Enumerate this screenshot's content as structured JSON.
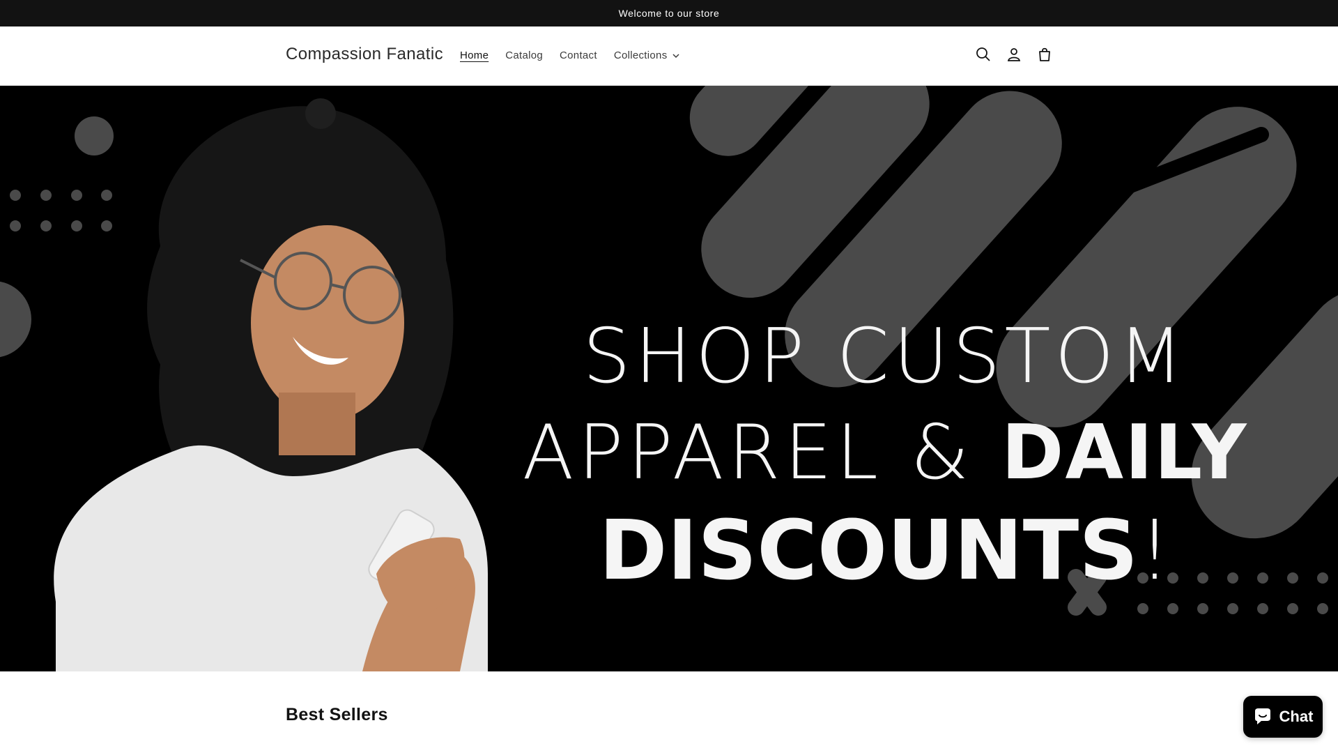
{
  "announcement": {
    "text": "Welcome to our store"
  },
  "header": {
    "logo": "Compassion Fanatic",
    "nav": [
      {
        "label": "Home",
        "active": true
      },
      {
        "label": "Catalog",
        "active": false
      },
      {
        "label": "Contact",
        "active": false
      },
      {
        "label": "Collections",
        "active": false,
        "has_dropdown": true
      }
    ],
    "icons": [
      "search-icon",
      "account-icon",
      "cart-icon"
    ]
  },
  "hero": {
    "line1": "SHOP CUSTOM",
    "line2_light": "APPAREL &",
    "line2_bold": "DAILY",
    "line3_bold": "DISCOUNTS",
    "line3_end": "!"
  },
  "best_sellers": {
    "title": "Best Sellers"
  },
  "chat": {
    "label": "Chat",
    "icon": "chat-bubble-icon"
  },
  "colors": {
    "announcement_bg": "#121212",
    "hero_bg": "#000000",
    "hero_shape": "#4a4a4a",
    "chat_bg": "#000000"
  }
}
